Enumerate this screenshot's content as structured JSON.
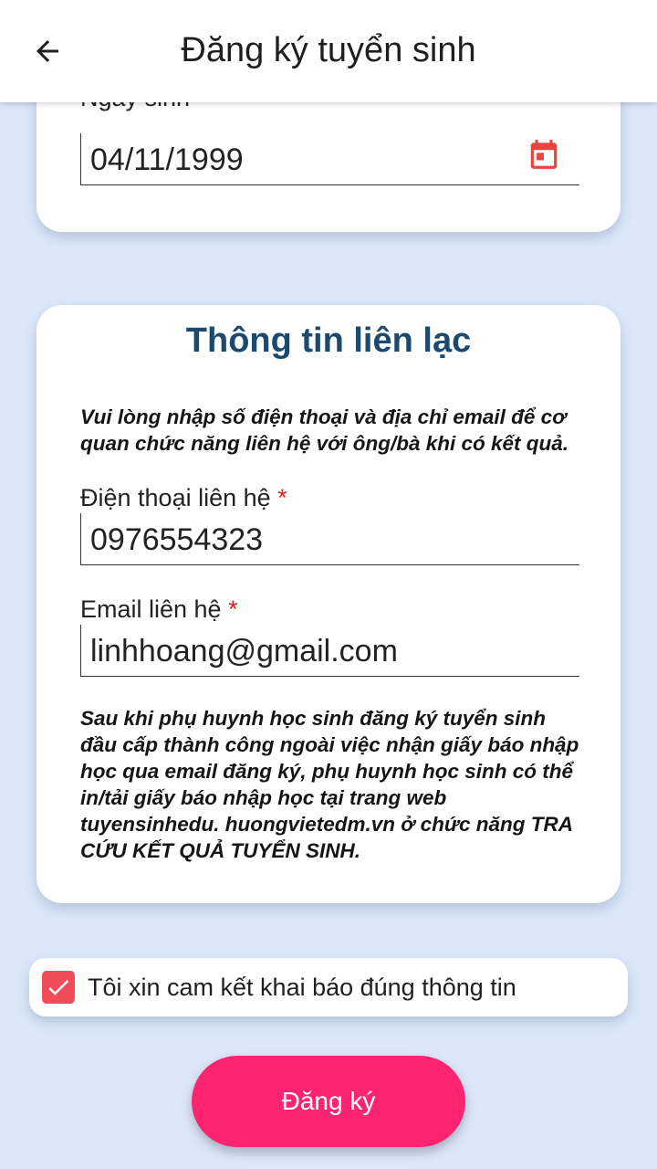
{
  "appbar": {
    "title": "Đăng ký tuyển sinh",
    "back_icon": "arrow-back-icon"
  },
  "birth_date": {
    "label": "Ngày sinh",
    "value": "04/11/1999",
    "icon": "calendar-icon"
  },
  "contact": {
    "title": "Thông tin liên lạc",
    "intro": "Vui lòng nhập số điện thoại và địa chỉ email để cơ quan chức năng liên hệ với ông/bà khi có kết quả.",
    "phone_label": "Điện thoại liên hệ",
    "phone_value": "0976554323",
    "email_label": "Email liên hệ",
    "email_value": "linhhoang@gmail.com",
    "required_mark": "*",
    "footnote": "Sau khi phụ huynh học sinh đăng ký tuyển sinh đầu cấp thành công ngoài việc nhận giấy báo nhập học qua email đăng ký, phụ huynh học sinh có thể in/tải giấy báo nhập học tại trang web tuyensinhedu. huongvietedm.vn ở chức năng TRA CỨU KẾT QUẢ TUYỂN SINH."
  },
  "commitment": {
    "label": "Tôi xin cam kết khai báo đúng thông tin",
    "checked": true,
    "checkbox_color": "#f24b5a"
  },
  "submit": {
    "label": "Đăng ký",
    "color": "#ff2470"
  },
  "colors": {
    "background": "#dce8fa",
    "section_title": "#1b4a6e",
    "icon_accent": "#e8453c"
  }
}
